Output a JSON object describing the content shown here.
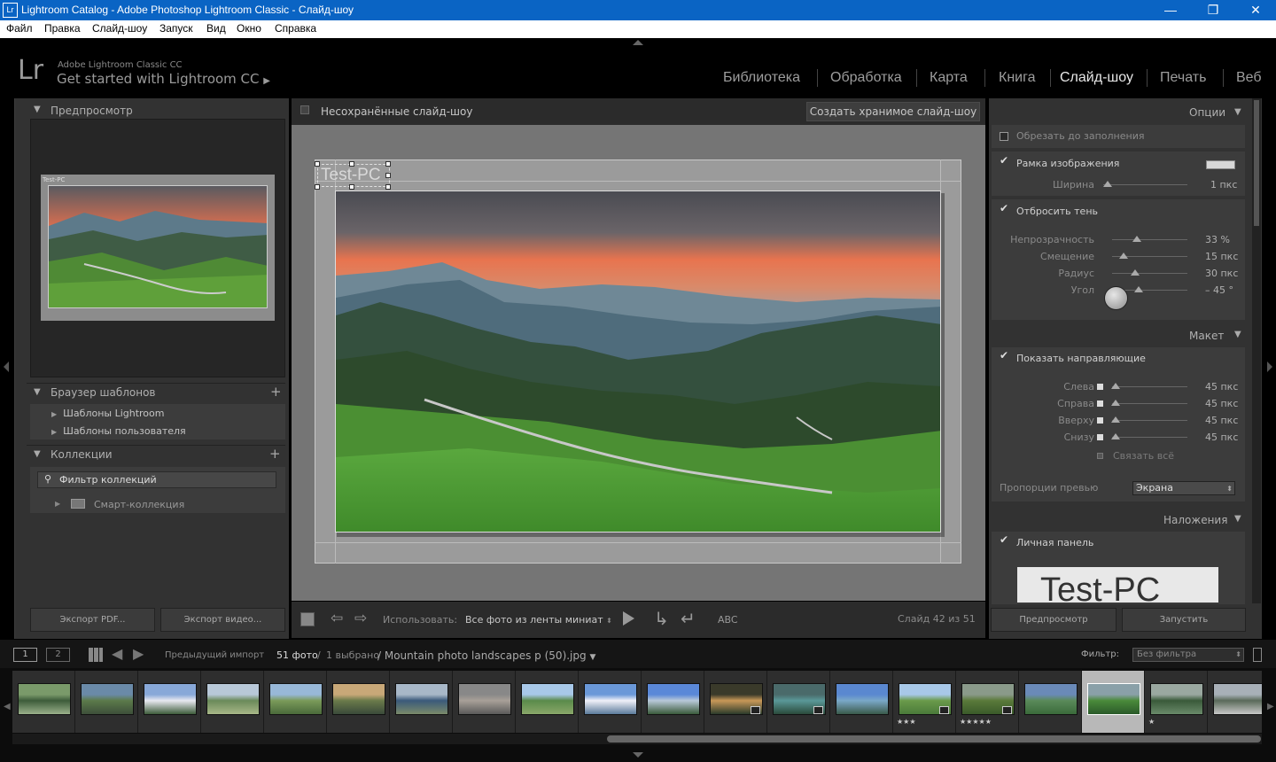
{
  "window": {
    "icon": "Lr",
    "title": "Lightroom Catalog - Adobe Photoshop Lightroom Classic - Слайд-шоу",
    "min": "—",
    "max": "❐",
    "close": "✕"
  },
  "menu": [
    "Файл",
    "Правка",
    "Слайд-шоу",
    "Запуск",
    "Вид",
    "Окно",
    "Справка"
  ],
  "identity": {
    "logo": "Lr",
    "product": "Adobe Lightroom Classic CC",
    "getstarted": "Get started with Lightroom CC",
    "arrow": "▶"
  },
  "modules": [
    "Библиотека",
    "Обработка",
    "Карта",
    "Книга",
    "Слайд-шоу",
    "Печать",
    "Веб"
  ],
  "active_module": "Слайд-шоу",
  "left": {
    "preview_title": "Предпросмотр",
    "preview_caption": "Test-PC",
    "templates_title": "Браузер шаблонов",
    "templates": [
      "Шаблоны Lightroom",
      "Шаблоны пользователя"
    ],
    "collections_title": "Коллекции",
    "collection_filter": "Фильтр коллекций",
    "smart_collection": "Смарт-коллекция",
    "export_pdf": "Экспорт PDF...",
    "export_video": "Экспорт видео..."
  },
  "center": {
    "header_title": "Несохранённые слайд-шоу",
    "create_button": "Создать хранимое слайд-шоу",
    "identity_text": "Test-PC",
    "toolbar": {
      "use_label": "Использовать:",
      "use_value": "Все фото из ленты миниат",
      "abc": "ABC",
      "slide_counter": "Слайд 42 из 51"
    }
  },
  "right": {
    "options_title": "Опции",
    "crop_fill": "Обрезать до заполнения",
    "image_border": "Рамка изображения",
    "border_width_label": "Ширина",
    "border_width_value": "1 пкс",
    "drop_shadow": "Отбросить тень",
    "shadow": [
      {
        "label": "Непрозрачность",
        "value": "33 %",
        "pos": 0.33
      },
      {
        "label": "Смещение",
        "value": "15 пкс",
        "pos": 0.15
      },
      {
        "label": "Радиус",
        "value": "30 пкс",
        "pos": 0.3
      },
      {
        "label": "Угол",
        "value": "– 45 °",
        "pos": 0.35
      }
    ],
    "layout_title": "Макет",
    "show_guides": "Показать направляющие",
    "guides": [
      {
        "label": "Слева",
        "value": "45 пкс",
        "pos": 0.05
      },
      {
        "label": "Справа",
        "value": "45 пкс",
        "pos": 0.05
      },
      {
        "label": "Вверху",
        "value": "45 пкс",
        "pos": 0.05
      },
      {
        "label": "Снизу",
        "value": "45 пкс",
        "pos": 0.05
      }
    ],
    "link_all": "Связать всё",
    "aspect_label": "Пропорции превью",
    "aspect_value": "Экрана",
    "overlays_title": "Наложения",
    "identity_plate": "Личная панель",
    "identity_plate_text": "Test-PC",
    "preview_button": "Предпросмотр",
    "play_button": "Запустить"
  },
  "filmstrip": {
    "page1": "1",
    "page2": "2",
    "source": "Предыдущий импорт",
    "count": "51 фото",
    "slash": "/",
    "selected": "1 выбрано",
    "filename": "/ Mountain photo landscapes p (50).jpg",
    "filter_label": "Фильтр:",
    "filter_value": "Без фильтра",
    "stars": [
      "",
      "",
      "",
      "",
      "",
      "",
      "",
      "",
      "",
      "",
      "",
      "",
      "",
      "",
      "★★★",
      "★★★★★",
      "",
      "",
      "★"
    ]
  },
  "colors": {
    "accent": "#0a64c4",
    "panel": "#323232",
    "bg": "#000000"
  }
}
